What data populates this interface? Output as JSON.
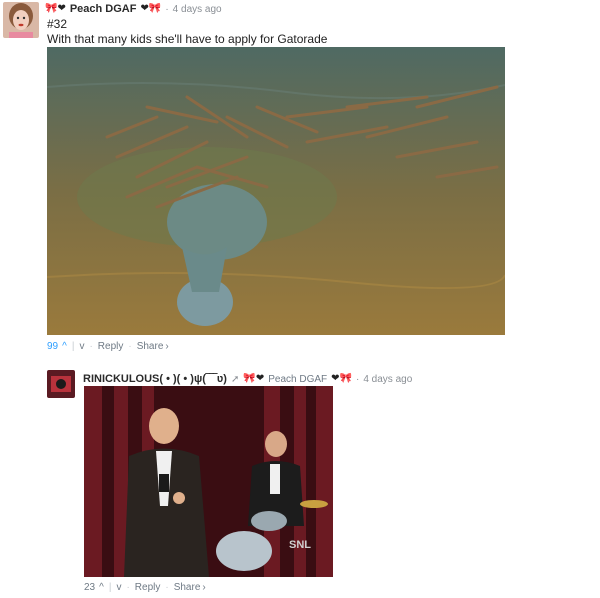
{
  "comment1": {
    "username": "Peach DGAF",
    "name_emojis": "🎀❤",
    "name_emojis_after": "🎀",
    "timestamp": "4 days ago",
    "number": "#32",
    "text": "With that many kids she'll have to apply for Gatorade",
    "votes": "99",
    "reply_label": "Reply",
    "share_label": "Share"
  },
  "comment2": {
    "username": "RINICKULOUS( • )( • )ψ(‾‾‾ʋ)",
    "arrow": "➚",
    "name_emojis": "🎀❤",
    "reply_to": "Peach DGAF",
    "reply_to_emojis": "❤🎀",
    "timestamp": "4 days ago",
    "votes": "23",
    "reply_label": "Reply",
    "share_label": "Share"
  }
}
